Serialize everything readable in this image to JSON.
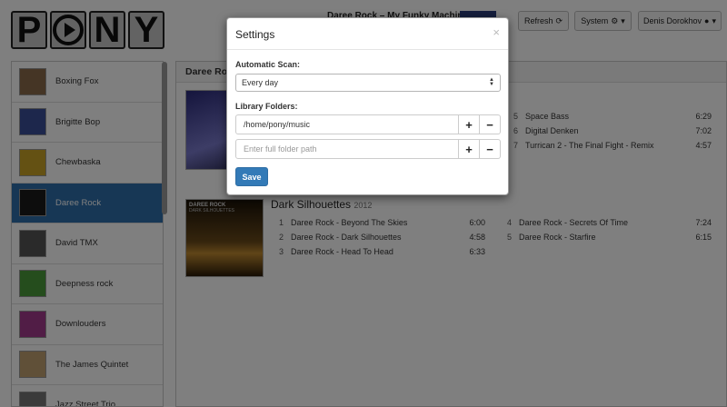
{
  "header": {
    "logo_letters": [
      "P",
      "N",
      "Y"
    ],
    "now_playing": "Daree Rock – My Funky Machine",
    "refresh_label": "Refresh",
    "system_label": "System",
    "user_label": "Denis Dorokhov"
  },
  "sidebar": {
    "artists": [
      {
        "name": "Boxing Fox",
        "color": "#8b6a4a"
      },
      {
        "name": "Brigitte Bop",
        "color": "#3b4f99"
      },
      {
        "name": "Chewbaska",
        "color": "#c9a227"
      },
      {
        "name": "Daree Rock",
        "color": "#1b1b1b",
        "active": true
      },
      {
        "name": "David TMX",
        "color": "#555555"
      },
      {
        "name": "Deepness rock",
        "color": "#4a9a3a"
      },
      {
        "name": "Downlouders",
        "color": "#a23a8c"
      },
      {
        "name": "The James Quintet",
        "color": "#c0a070"
      },
      {
        "name": "Jazz Street Trio",
        "color": "#777777"
      }
    ]
  },
  "main": {
    "artist_heading": "Daree Rock",
    "album1": {
      "tracks": [
        {
          "num": "5",
          "name": "Space Bass",
          "dur": "6:29"
        },
        {
          "num": "6",
          "name": "Digital Denken",
          "dur": "7:02"
        },
        {
          "num": "7",
          "name": "Turrican 2 - The Final Fight - Remix",
          "dur": "4:57"
        }
      ]
    },
    "album2": {
      "title": "Dark Silhouettes",
      "year": "2012",
      "cover_text": "DAREE ROCK",
      "cover_subtext": "DARK SILHOUETTES",
      "tracks_left": [
        {
          "num": "1",
          "name": "Daree Rock - Beyond The Skies",
          "dur": "6:00"
        },
        {
          "num": "2",
          "name": "Daree Rock - Dark Silhouettes",
          "dur": "4:58"
        },
        {
          "num": "3",
          "name": "Daree Rock - Head To Head",
          "dur": "6:33"
        }
      ],
      "tracks_right": [
        {
          "num": "4",
          "name": "Daree Rock - Secrets Of Time",
          "dur": "7:24"
        },
        {
          "num": "5",
          "name": "Daree Rock - Starfire",
          "dur": "6:15"
        }
      ]
    }
  },
  "modal": {
    "title": "Settings",
    "close_symbol": "×",
    "scan_label": "Automatic Scan:",
    "scan_value": "Every day",
    "folders_label": "Library Folders:",
    "folder_value": "/home/pony/music",
    "folder_placeholder": "Enter full folder path",
    "add_symbol": "+",
    "remove_symbol": "−",
    "save_label": "Save"
  }
}
